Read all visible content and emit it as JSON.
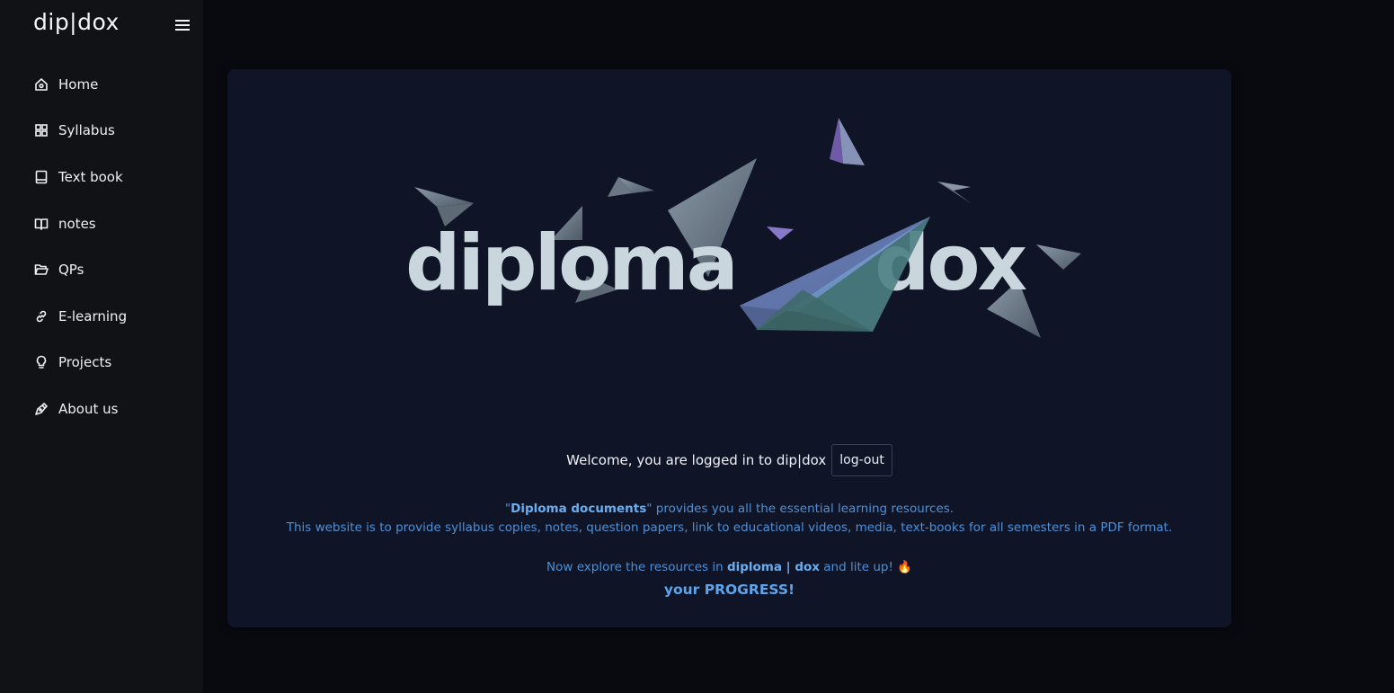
{
  "brand": {
    "text": "dip|dox"
  },
  "sidebar": {
    "items": [
      {
        "label": "Home",
        "icon": "home-icon"
      },
      {
        "label": "Syllabus",
        "icon": "grid-icon"
      },
      {
        "label": "Text book",
        "icon": "book-icon"
      },
      {
        "label": "notes",
        "icon": "open-book-icon"
      },
      {
        "label": "QPs",
        "icon": "folder-open-icon"
      },
      {
        "label": "E-learning",
        "icon": "link-icon"
      },
      {
        "label": "Projects",
        "icon": "lightbulb-icon"
      },
      {
        "label": "About us",
        "icon": "pen-nib-icon"
      }
    ]
  },
  "hero": {
    "word_left": "diploma",
    "word_right": "dox"
  },
  "welcome": {
    "text": "Welcome, you are logged in to dip|dox",
    "logout_label": "log-out"
  },
  "description": {
    "quote_open": "\"",
    "highlight_1": "Diploma documents",
    "quote_close": "\"",
    "line1_rest": " provides you all the essential learning resources.",
    "line2": "This website is to provide syllabus copies, notes, question papers, link to educational videos, media, text-books for all semesters in a PDF format.",
    "line3_start": "Now explore the resources in ",
    "highlight_2": "diploma | dox",
    "line3_end": " and lite up! ",
    "flame": "🔥",
    "line4": "your PROGRESS!"
  },
  "colors": {
    "sidebar_bg": "#101216",
    "page_bg": "#080a10",
    "card_bg": "#0f1527",
    "accent_blue": "#4f8fd6",
    "logo_text": "#c9d6dd"
  }
}
